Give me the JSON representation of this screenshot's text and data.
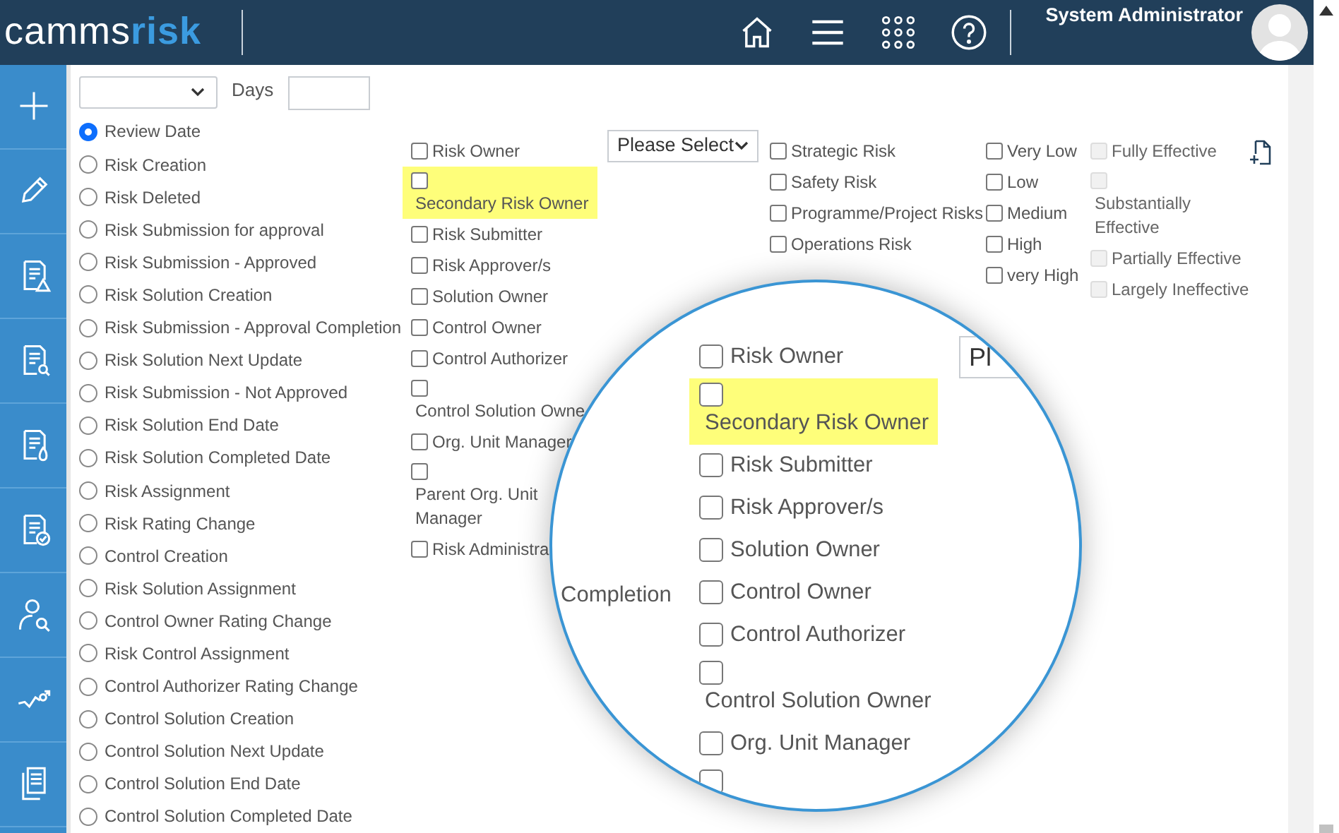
{
  "header": {
    "logo": {
      "part_1": "camms",
      "part_2": "risk"
    },
    "user": "System Administrator"
  },
  "filter": {
    "days_label": "Days"
  },
  "date_options": [
    {
      "label": "Review Date",
      "selected": true
    },
    {
      "label": "Risk Creation",
      "selected": false
    },
    {
      "label": "Risk Deleted",
      "selected": false
    },
    {
      "label": "Risk Submission for approval",
      "selected": false
    },
    {
      "label": "Risk Submission - Approved",
      "selected": false
    },
    {
      "label": "Risk Solution Creation",
      "selected": false
    },
    {
      "label": "Risk Submission - Approval Completion",
      "selected": false
    },
    {
      "label": "Risk Solution Next Update",
      "selected": false
    },
    {
      "label": "Risk Submission - Not Approved",
      "selected": false
    },
    {
      "label": "Risk Solution End Date",
      "selected": false
    },
    {
      "label": "Risk Solution Completed Date",
      "selected": false
    },
    {
      "label": "Risk Assignment",
      "selected": false
    },
    {
      "label": "Risk Rating Change",
      "selected": false
    },
    {
      "label": "Control Creation",
      "selected": false
    },
    {
      "label": "Risk Solution Assignment",
      "selected": false
    },
    {
      "label": "Control Owner Rating Change",
      "selected": false
    },
    {
      "label": "Risk Control Assignment",
      "selected": false
    },
    {
      "label": "Control Authorizer Rating Change",
      "selected": false
    },
    {
      "label": "Control Solution Creation",
      "selected": false
    },
    {
      "label": "Control Solution Next Update",
      "selected": false
    },
    {
      "label": "Control Solution End Date",
      "selected": false
    },
    {
      "label": "Control Solution Completed Date",
      "selected": false
    }
  ],
  "roles": [
    {
      "label": "Risk Owner",
      "checked": false,
      "highlighted": false,
      "kind": "inline"
    },
    {
      "label": "Secondary Risk Owner",
      "checked": false,
      "highlighted": true,
      "kind": "stacked"
    },
    {
      "label": "Risk Submitter",
      "checked": false,
      "highlighted": false,
      "kind": "inline"
    },
    {
      "label": "Risk Approver/s",
      "checked": false,
      "highlighted": false,
      "kind": "inline"
    },
    {
      "label": "Solution Owner",
      "checked": false,
      "highlighted": false,
      "kind": "inline"
    },
    {
      "label": "Control Owner",
      "checked": false,
      "highlighted": false,
      "kind": "inline"
    },
    {
      "label": "Control Authorizer",
      "checked": false,
      "highlighted": false,
      "kind": "inline"
    },
    {
      "label": "Control Solution Owne",
      "checked": false,
      "highlighted": false,
      "kind": "stacked"
    },
    {
      "label": "Org. Unit Manager",
      "checked": false,
      "highlighted": false,
      "kind": "inline"
    },
    {
      "label": "Parent Org. Unit Manager",
      "checked": false,
      "highlighted": false,
      "kind": "stacked"
    },
    {
      "label": "Risk Administra",
      "checked": false,
      "highlighted": false,
      "kind": "inline"
    }
  ],
  "category_select": {
    "value": "Please Select"
  },
  "risk_types": [
    {
      "label": "Strategic Risk",
      "checked": false
    },
    {
      "label": "Safety Risk",
      "checked": false
    },
    {
      "label": "Programme/Project Risks",
      "checked": false
    },
    {
      "label": "Operations Risk",
      "checked": false
    }
  ],
  "ratings": [
    {
      "label": "Very Low",
      "checked": false
    },
    {
      "label": "Low",
      "checked": false
    },
    {
      "label": "Medium",
      "checked": false
    },
    {
      "label": "High",
      "checked": false
    },
    {
      "label": "very High",
      "checked": false
    }
  ],
  "effectiveness": [
    {
      "label": "Fully Effective",
      "checked": false,
      "disabled": true,
      "kind": "inline"
    },
    {
      "label": "Substantially Effective",
      "checked": false,
      "disabled": true,
      "kind": "stacked"
    },
    {
      "label": "Partially Effective",
      "checked": false,
      "disabled": true,
      "kind": "inline"
    },
    {
      "label": "Largely Ineffective",
      "checked": false,
      "disabled": true,
      "kind": "inline"
    }
  ],
  "magnifier": {
    "fragment": "Completion",
    "select_value": "Pl",
    "roles": [
      {
        "label": "Risk Owner",
        "checked": false,
        "highlighted": false,
        "kind": "inline"
      },
      {
        "label": "Secondary Risk Owner",
        "checked": false,
        "highlighted": true,
        "kind": "stacked"
      },
      {
        "label": "Risk Submitter",
        "checked": false,
        "highlighted": false,
        "kind": "inline"
      },
      {
        "label": "Risk Approver/s",
        "checked": false,
        "highlighted": false,
        "kind": "inline"
      },
      {
        "label": "Solution Owner",
        "checked": false,
        "highlighted": false,
        "kind": "inline"
      },
      {
        "label": "Control Owner",
        "checked": false,
        "highlighted": false,
        "kind": "inline"
      },
      {
        "label": "Control Authorizer",
        "checked": false,
        "highlighted": false,
        "kind": "inline"
      },
      {
        "label": "Control Solution Owner",
        "checked": false,
        "highlighted": false,
        "kind": "stacked"
      },
      {
        "label": "Org. Unit Manager",
        "checked": false,
        "highlighted": false,
        "kind": "inline"
      },
      {
        "checked": false,
        "highlighted": false,
        "kind": "stacked"
      }
    ]
  }
}
